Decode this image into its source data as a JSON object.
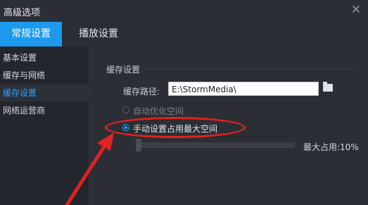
{
  "window": {
    "title": "高级选项",
    "close_icon": "close-icon"
  },
  "tabs": [
    {
      "label": "常规设置",
      "active": true
    },
    {
      "label": "播放设置",
      "active": false
    }
  ],
  "sidebar": {
    "items": [
      {
        "label": "基本设置",
        "selected": false
      },
      {
        "label": "缓存与网络",
        "selected": false
      },
      {
        "label": "缓存设置",
        "selected": true
      },
      {
        "label": "网络运营商",
        "selected": false
      }
    ]
  },
  "cache": {
    "section_title": "缓存设置",
    "path_label": "缓存路径:",
    "path_value": "E:\\StormMedia\\",
    "folder_icon": "folder-icon",
    "options": [
      {
        "label": "自动优化空间",
        "checked": false,
        "enabled": false
      },
      {
        "label": "手动设置占用最大空间",
        "checked": true,
        "enabled": true
      }
    ],
    "max_usage_label": "最大占用:10%",
    "max_usage_fraction": 0.1
  },
  "colors": {
    "accent": "#1d99ee",
    "selected_text": "#2aa3ff",
    "annotation_red": "#e02222"
  }
}
